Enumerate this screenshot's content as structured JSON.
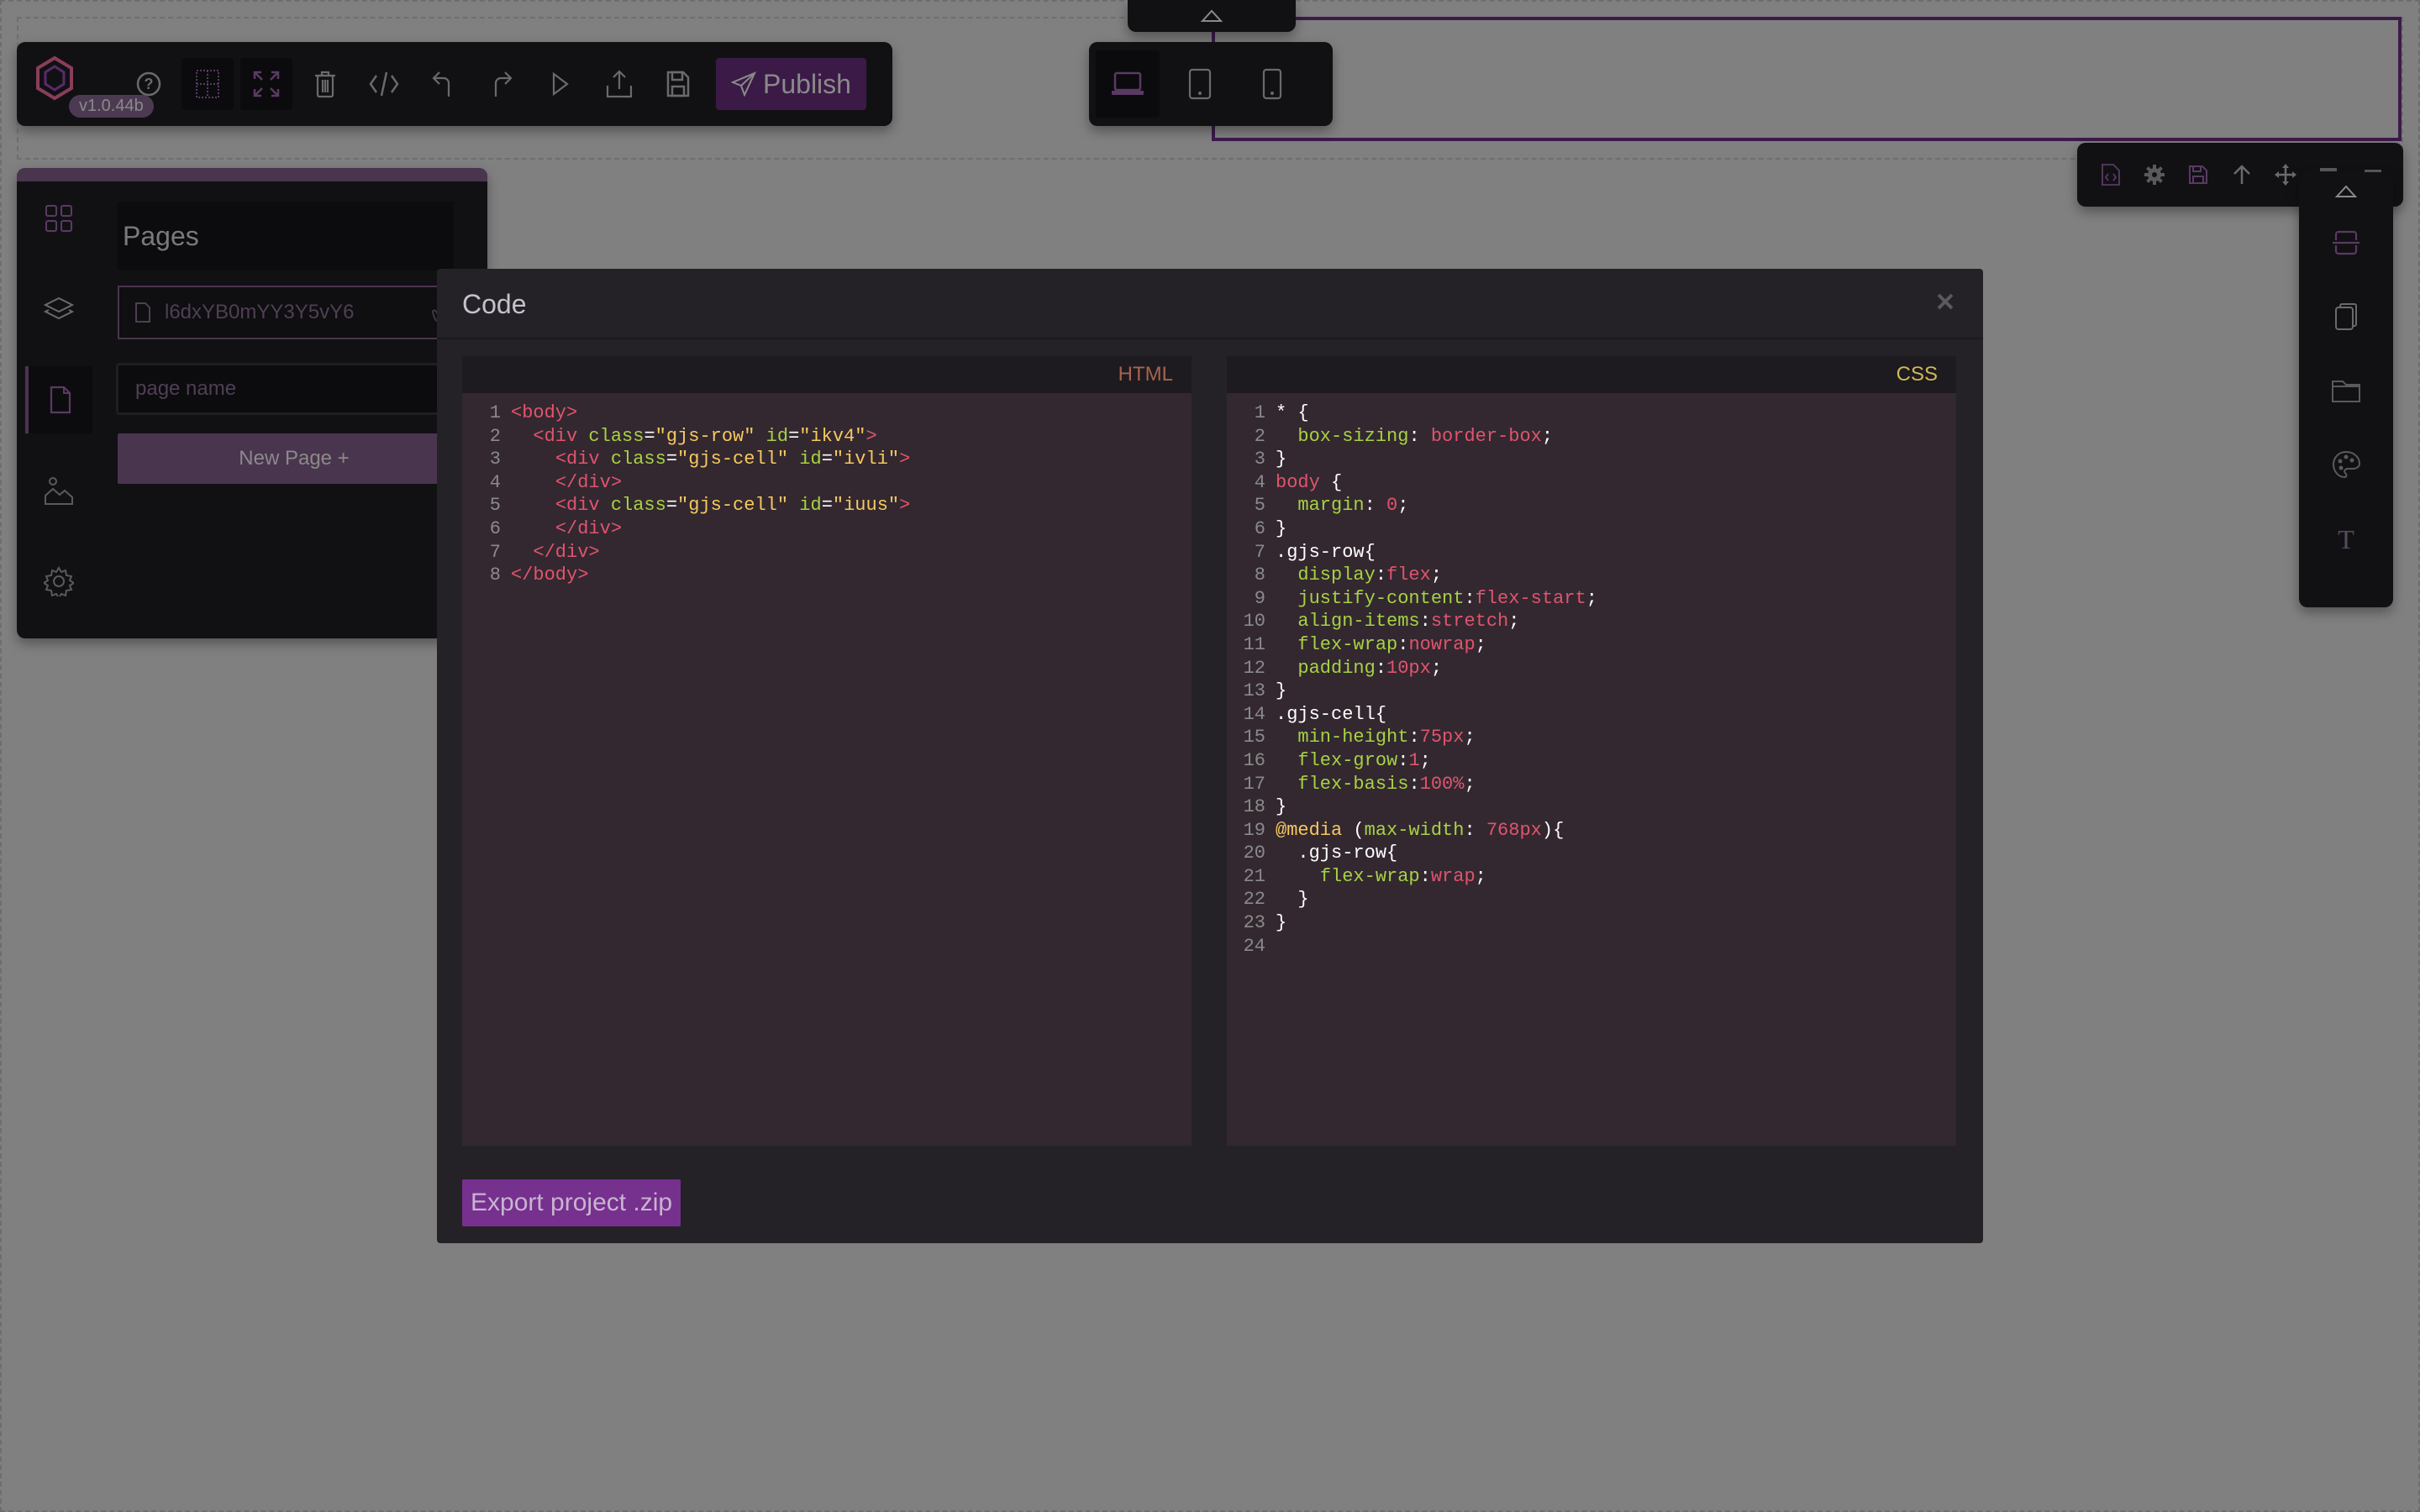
{
  "toolbar": {
    "version": "v1.0.44b",
    "publish_label": "Publish",
    "buttons": [
      "help",
      "sw-visibility",
      "fullscreen",
      "clear-canvas",
      "export-code",
      "undo",
      "redo",
      "preview",
      "import",
      "save"
    ]
  },
  "devices": {
    "items": [
      "desktop",
      "tablet",
      "mobile"
    ],
    "active": "desktop"
  },
  "left_panel": {
    "title": "Pages",
    "current_page": "l6dxYB0mYY3Y5vY6",
    "page_name_placeholder": "page name",
    "new_page_label": "New Page +",
    "sidebar": [
      "blocks",
      "layers",
      "pages",
      "assets",
      "settings"
    ],
    "active_sidebar": "pages"
  },
  "modal": {
    "title": "Code",
    "close_label": "×",
    "html_label": "HTML",
    "css_label": "CSS",
    "export_label": "Export project .zip",
    "html_lines": [
      [
        [
          "tag",
          "<body>"
        ]
      ],
      [
        [
          "",
          "  "
        ],
        [
          "tag",
          "<div "
        ],
        [
          "attr",
          "class"
        ],
        [
          "punc",
          "="
        ],
        [
          "str",
          "\"gjs-row\""
        ],
        [
          "",
          " "
        ],
        [
          "attr",
          "id"
        ],
        [
          "punc",
          "="
        ],
        [
          "str",
          "\"ikv4\""
        ],
        [
          "tag",
          ">"
        ]
      ],
      [
        [
          "",
          "    "
        ],
        [
          "tag",
          "<div "
        ],
        [
          "attr",
          "class"
        ],
        [
          "punc",
          "="
        ],
        [
          "str",
          "\"gjs-cell\""
        ],
        [
          "",
          " "
        ],
        [
          "attr",
          "id"
        ],
        [
          "punc",
          "="
        ],
        [
          "str",
          "\"ivli\""
        ],
        [
          "tag",
          ">"
        ]
      ],
      [
        [
          "",
          "    "
        ],
        [
          "tag",
          "</div>"
        ]
      ],
      [
        [
          "",
          "    "
        ],
        [
          "tag",
          "<div "
        ],
        [
          "attr",
          "class"
        ],
        [
          "punc",
          "="
        ],
        [
          "str",
          "\"gjs-cell\""
        ],
        [
          "",
          " "
        ],
        [
          "attr",
          "id"
        ],
        [
          "punc",
          "="
        ],
        [
          "str",
          "\"iuus\""
        ],
        [
          "tag",
          ">"
        ]
      ],
      [
        [
          "",
          "    "
        ],
        [
          "tag",
          "</div>"
        ]
      ],
      [
        [
          "",
          "  "
        ],
        [
          "tag",
          "</div>"
        ]
      ],
      [
        [
          "tag",
          "</body>"
        ]
      ]
    ],
    "css_lines": [
      [
        [
          "punc",
          "* {"
        ]
      ],
      [
        [
          "",
          "  "
        ],
        [
          "attr",
          "box-sizing"
        ],
        [
          "punc",
          ": "
        ],
        [
          "val",
          "border-box"
        ],
        [
          "punc",
          ";"
        ]
      ],
      [
        [
          "punc",
          "}"
        ]
      ],
      [
        [
          "tag",
          "body"
        ],
        [
          "punc",
          " {"
        ]
      ],
      [
        [
          "",
          "  "
        ],
        [
          "attr",
          "margin"
        ],
        [
          "punc",
          ": "
        ],
        [
          "val",
          "0"
        ],
        [
          "punc",
          ";"
        ]
      ],
      [
        [
          "punc",
          "}"
        ]
      ],
      [
        [
          "punc",
          ".gjs-row{"
        ]
      ],
      [
        [
          "",
          "  "
        ],
        [
          "attr",
          "display"
        ],
        [
          "punc",
          ":"
        ],
        [
          "val",
          "flex"
        ],
        [
          "punc",
          ";"
        ]
      ],
      [
        [
          "",
          "  "
        ],
        [
          "attr",
          "justify-content"
        ],
        [
          "punc",
          ":"
        ],
        [
          "val",
          "flex-start"
        ],
        [
          "punc",
          ";"
        ]
      ],
      [
        [
          "",
          "  "
        ],
        [
          "attr",
          "align-items"
        ],
        [
          "punc",
          ":"
        ],
        [
          "val",
          "stretch"
        ],
        [
          "punc",
          ";"
        ]
      ],
      [
        [
          "",
          "  "
        ],
        [
          "attr",
          "flex-wrap"
        ],
        [
          "punc",
          ":"
        ],
        [
          "val",
          "nowrap"
        ],
        [
          "punc",
          ";"
        ]
      ],
      [
        [
          "",
          "  "
        ],
        [
          "attr",
          "padding"
        ],
        [
          "punc",
          ":"
        ],
        [
          "val",
          "10px"
        ],
        [
          "punc",
          ";"
        ]
      ],
      [
        [
          "punc",
          "}"
        ]
      ],
      [
        [
          "punc",
          ".gjs-cell{"
        ]
      ],
      [
        [
          "",
          "  "
        ],
        [
          "attr",
          "min-height"
        ],
        [
          "punc",
          ":"
        ],
        [
          "val",
          "75px"
        ],
        [
          "punc",
          ";"
        ]
      ],
      [
        [
          "",
          "  "
        ],
        [
          "attr",
          "flex-grow"
        ],
        [
          "punc",
          ":"
        ],
        [
          "val",
          "1"
        ],
        [
          "punc",
          ";"
        ]
      ],
      [
        [
          "",
          "  "
        ],
        [
          "attr",
          "flex-basis"
        ],
        [
          "punc",
          ":"
        ],
        [
          "val",
          "100%"
        ],
        [
          "punc",
          ";"
        ]
      ],
      [
        [
          "punc",
          "}"
        ]
      ],
      [
        [
          "at",
          "@media"
        ],
        [
          "punc",
          " ("
        ],
        [
          "attr",
          "max-width"
        ],
        [
          "punc",
          ": "
        ],
        [
          "val",
          "768px"
        ],
        [
          "punc",
          "){"
        ]
      ],
      [
        [
          "",
          "  "
        ],
        [
          "punc",
          ".gjs-row{"
        ]
      ],
      [
        [
          "",
          "    "
        ],
        [
          "attr",
          "flex-wrap"
        ],
        [
          "punc",
          ":"
        ],
        [
          "val",
          "wrap"
        ],
        [
          "punc",
          ";"
        ]
      ],
      [
        [
          "",
          "  "
        ],
        [
          "punc",
          "}"
        ]
      ],
      [
        [
          "punc",
          "}"
        ]
      ],
      []
    ]
  },
  "colors": {
    "accent": "#76308e",
    "panel_bg": "#111114",
    "canvas_bg": "#808080",
    "selection": "#3d1a4a"
  }
}
